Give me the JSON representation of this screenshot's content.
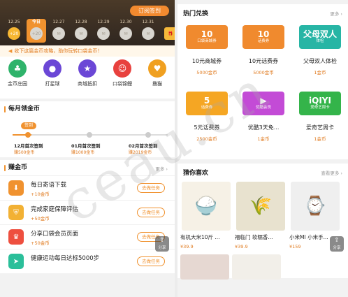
{
  "left": {
    "checkin_label": "订阅签到",
    "days": [
      {
        "date": "12.25",
        "reward": "+20",
        "state": "active"
      },
      {
        "date": "今日",
        "reward": "+20",
        "state": "today"
      },
      {
        "date": "12.27",
        "reward": "",
        "state": "pending"
      },
      {
        "date": "12.28",
        "reward": "",
        "state": "pending"
      },
      {
        "date": "12.29",
        "reward": "",
        "state": "pending"
      },
      {
        "date": "12.30",
        "reward": "",
        "state": "pending"
      },
      {
        "date": "12.31",
        "reward": "",
        "state": "pending"
      },
      {
        "date": "",
        "reward": "",
        "state": "gift"
      }
    ],
    "tip": "收下这篇金币攻略，助你玩转口袋金币！",
    "quick_links": [
      {
        "label": "金币庄园",
        "icon": "farm-icon",
        "color": "#2fb36b"
      },
      {
        "label": "打星球",
        "icon": "planet-icon",
        "color": "#6b47d6"
      },
      {
        "label": "商城抵扣",
        "icon": "star-icon",
        "color": "#6b47d6"
      },
      {
        "label": "口袋锦鲤",
        "icon": "ghost-icon",
        "color": "#e8413e"
      },
      {
        "label": "撸猫",
        "icon": "cat-icon",
        "color": "#f0a020"
      }
    ],
    "monthly": {
      "title": "每月领金币",
      "signed_tag": "签到",
      "milestones": [
        {
          "label": "12月首次签到",
          "reward": "赚500金币"
        },
        {
          "label": "01月首次签到",
          "reward": "赚1000金币"
        },
        {
          "label": "02月首次签到",
          "reward": "赚2019金币"
        }
      ]
    },
    "earn": {
      "title": "赚金币",
      "more": "更多",
      "tasks": [
        {
          "title": "每日寄语下载",
          "reward": "+10金币",
          "button": "去做任务",
          "color": "#f0922f",
          "icon": "download-icon"
        },
        {
          "title": "完成家庭保障评估",
          "reward": "+50金币",
          "button": "去做任务",
          "color": "#f2b134",
          "icon": "shield-icon"
        },
        {
          "title": "分享口袋会员页面",
          "reward": "+50金币",
          "button": "去做任务",
          "color": "#ee4f3f",
          "icon": "crown-icon"
        },
        {
          "title": "健康运动每日达标5000步",
          "reward": "",
          "button": "去做任务",
          "color": "#2bbf9a",
          "icon": "run-icon"
        }
      ]
    },
    "share_label": "分享"
  },
  "right": {
    "hot": {
      "title": "热门兑换",
      "more": "更多",
      "items": [
        {
          "name": "10元商城券",
          "price": "5000金币",
          "big": "10",
          "small": "口袋商城券",
          "color": "#f08a2e"
        },
        {
          "name": "10元话费券",
          "price": "5000金币",
          "big": "10",
          "small": "话费券",
          "color": "#f08a2e"
        },
        {
          "name": "父母双人体检",
          "price": "1金币",
          "big": "父母双人",
          "small": "体检",
          "color": "#27b5a5"
        },
        {
          "name": "5元话费券",
          "price": "2500金币",
          "big": "5",
          "small": "话费券",
          "color": "#f5a623"
        },
        {
          "name": "优酷3天免...",
          "price": "1金币",
          "big": "▶",
          "small": "优酷会员",
          "color": "#c34bd6"
        },
        {
          "name": "爱奇艺周卡",
          "price": "1金币",
          "big": "iQIYI",
          "small": "爱奇艺周卡",
          "color": "#34b44a"
        }
      ]
    },
    "guess": {
      "title": "猜你喜欢",
      "more": "查看更多",
      "products": [
        {
          "name": "有机大米10斤 ...",
          "price": "¥39.9",
          "icon": "rice-bowl-icon"
        },
        {
          "name": "福临门 软糯香...",
          "price": "¥39.9",
          "icon": "rice-bag-icon"
        },
        {
          "name": "小米MI 小米手...",
          "price": "¥159",
          "icon": "band-icon"
        }
      ]
    },
    "share_label": "分享"
  },
  "watermark": "ceau.cn"
}
